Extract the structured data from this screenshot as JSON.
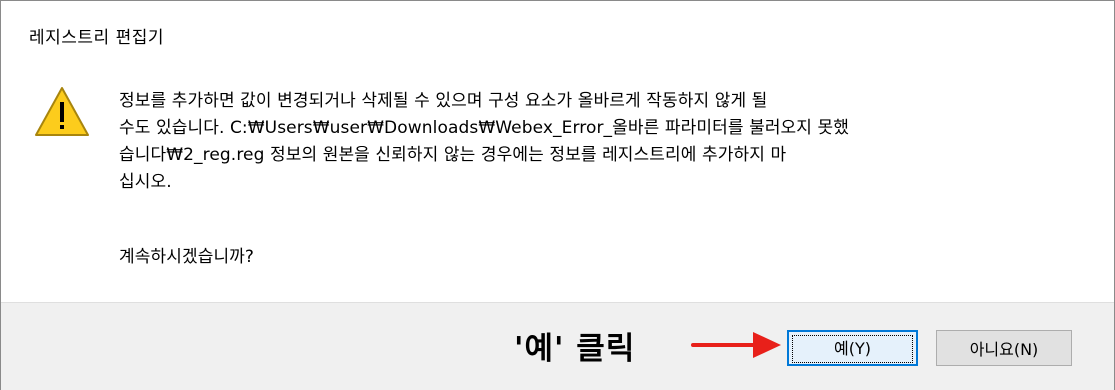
{
  "window": {
    "title": "레지스트리 편집기"
  },
  "dialog": {
    "icon": "warning-icon",
    "message": "정보를 추가하면 값이 변경되거나 삭제될 수 있으며 구성 요소가 올바르게 작동하지 않게 될\n수도 있습니다. C:₩Users₩user₩Downloads₩Webex_Error_올바른 파라미터를 불러오지 못했\n습니다₩2_reg.reg 정보의 원본을 신뢰하지 않는 경우에는 정보를 레지스트리에 추가하지 마\n십시오.",
    "question": "계속하시겠습니까?"
  },
  "annotation": {
    "text": "'예' 클릭",
    "arrow_color": "#e8201a"
  },
  "buttons": {
    "yes_label": "예(Y)",
    "no_label": "아니요(N)"
  },
  "colors": {
    "warning_fill": "#fccc1c",
    "warning_border": "#a8850d",
    "focus_border": "#0078d7",
    "footer_bg": "#f0f0f0"
  }
}
